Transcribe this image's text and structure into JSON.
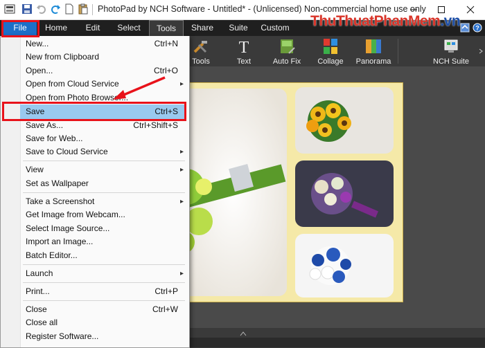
{
  "window": {
    "title": "PhotoPad by NCH Software - Untitled* - (Unlicensed) Non-commercial home use only"
  },
  "menubar": {
    "tabs": [
      "File",
      "Home",
      "Edit",
      "Select",
      "Tools",
      "Share",
      "Suite",
      "Custom"
    ],
    "active": "Tools"
  },
  "ribbon": {
    "buttons": [
      {
        "label": "Tools",
        "icon": "tools-icon"
      },
      {
        "label": "Text",
        "icon": "text-icon"
      },
      {
        "label": "Auto Fix",
        "icon": "auto-fix-icon"
      },
      {
        "label": "Collage",
        "icon": "collage-icon"
      },
      {
        "label": "Panorama",
        "icon": "panorama-icon"
      },
      {
        "label": "NCH Suite",
        "icon": "nch-suite-icon"
      }
    ]
  },
  "watermark": {
    "part1": "ThuThuat",
    "part2": "PhanMem",
    "part3": ".vn"
  },
  "file_menu": {
    "items": [
      {
        "label": "New...",
        "shortcut": "Ctrl+N"
      },
      {
        "label": "New from Clipboard",
        "shortcut": ""
      },
      {
        "label": "Open...",
        "shortcut": "Ctrl+O"
      },
      {
        "label": "Open from Cloud Service",
        "shortcut": ""
      },
      {
        "label": "Open from Photo Browser...",
        "shortcut": ""
      },
      {
        "label": "Save",
        "shortcut": "Ctrl+S"
      },
      {
        "label": "Save As...",
        "shortcut": "Ctrl+Shift+S"
      },
      {
        "label": "Save for Web...",
        "shortcut": ""
      },
      {
        "label": "Save to Cloud Service",
        "shortcut": ""
      },
      {
        "label": "View",
        "shortcut": ""
      },
      {
        "label": "Set as Wallpaper",
        "shortcut": ""
      },
      {
        "label": "Take a Screenshot",
        "shortcut": ""
      },
      {
        "label": "Get Image from Webcam...",
        "shortcut": ""
      },
      {
        "label": "Select Image Source...",
        "shortcut": ""
      },
      {
        "label": "Import an Image...",
        "shortcut": ""
      },
      {
        "label": "Batch Editor...",
        "shortcut": ""
      },
      {
        "label": "Launch",
        "shortcut": ""
      },
      {
        "label": "Print...",
        "shortcut": "Ctrl+P"
      },
      {
        "label": "Close",
        "shortcut": "Ctrl+W"
      },
      {
        "label": "Close all",
        "shortcut": ""
      },
      {
        "label": "Register Software...",
        "shortcut": ""
      }
    ],
    "selected": "Save"
  },
  "colors": {
    "accent": "#1c6fc8",
    "highlight": "#e8121a",
    "menu_selected": "#99c9ef"
  }
}
